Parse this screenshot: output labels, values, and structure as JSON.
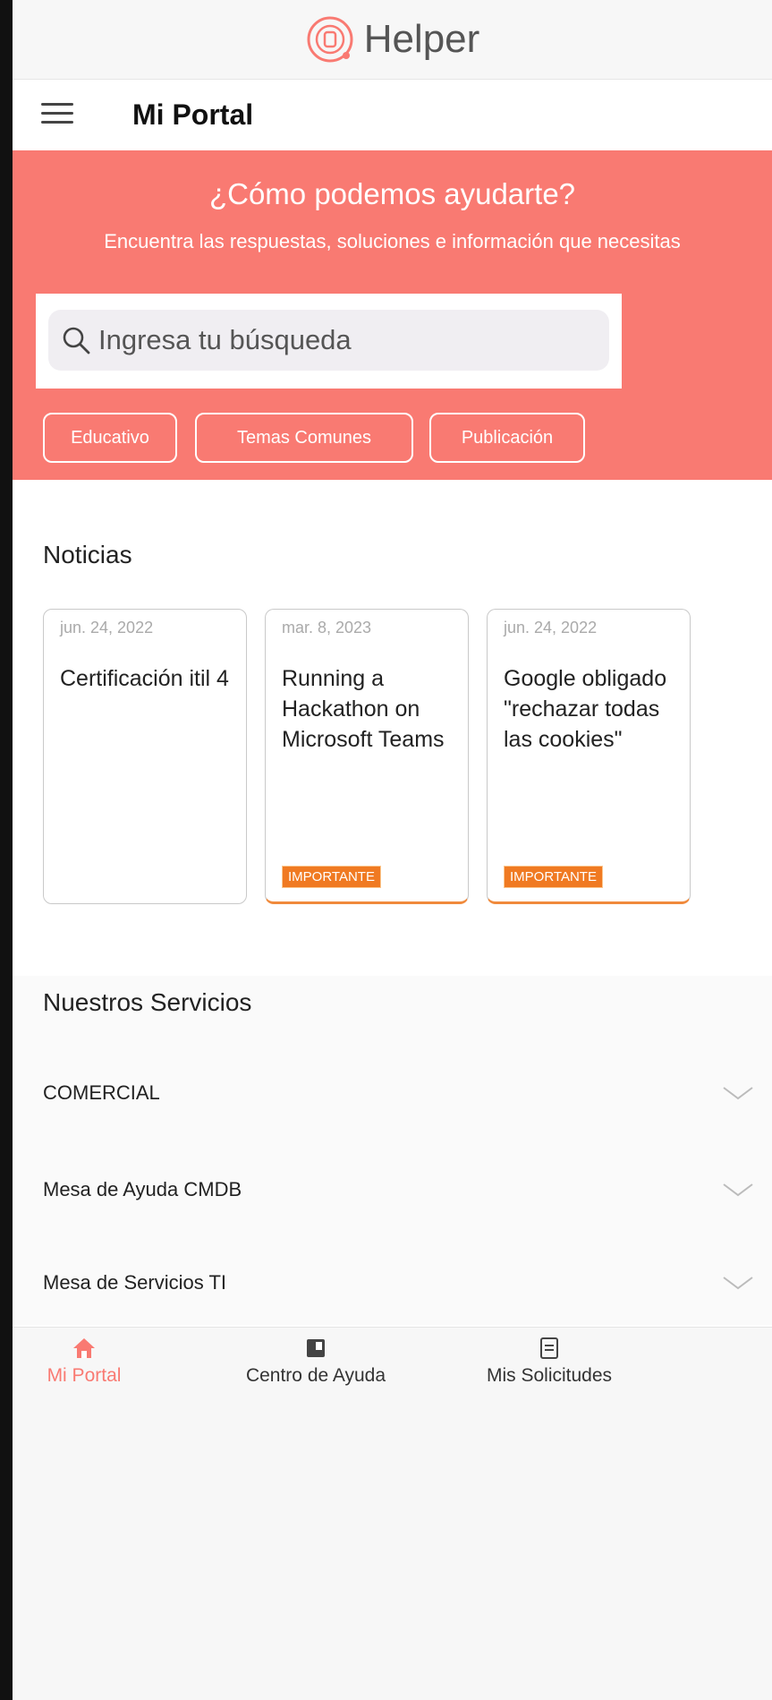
{
  "app": {
    "name": "Helper"
  },
  "header": {
    "title": "Mi Portal"
  },
  "hero": {
    "title": "¿Cómo podemos ayudarte?",
    "subtitle": "Encuentra las respuestas, soluciones e información que necesitas",
    "search": {
      "placeholder": "Ingresa tu búsqueda",
      "value": ""
    },
    "chips": [
      "Educativo",
      "Temas Comunes",
      "Publicación"
    ]
  },
  "news": {
    "title": "Noticias",
    "items": [
      {
        "date": "jun. 24, 2022",
        "title": "Certificación itil 4",
        "badge": ""
      },
      {
        "date": "mar. 8, 2023",
        "title": "Running a Hackathon on Microsoft Teams",
        "badge": "IMPORTANTE"
      },
      {
        "date": "jun. 24, 2022",
        "title": "Google obligado \"rechazar todas las cookies\"",
        "badge": "IMPORTANTE"
      }
    ]
  },
  "services": {
    "title": "Nuestros Servicios",
    "items": [
      "COMERCIAL",
      "Mesa de Ayuda CMDB",
      "Mesa de Servicios TI"
    ]
  },
  "bottom_nav": {
    "items": [
      {
        "label": "Mi Portal",
        "icon": "home-icon",
        "active": true
      },
      {
        "label": "Centro de Ayuda",
        "icon": "book-icon",
        "active": false
      },
      {
        "label": "Mis Solicitudes",
        "icon": "document-icon",
        "active": false
      }
    ]
  },
  "colors": {
    "accent": "#f97a72",
    "badge": "#f07a22"
  }
}
